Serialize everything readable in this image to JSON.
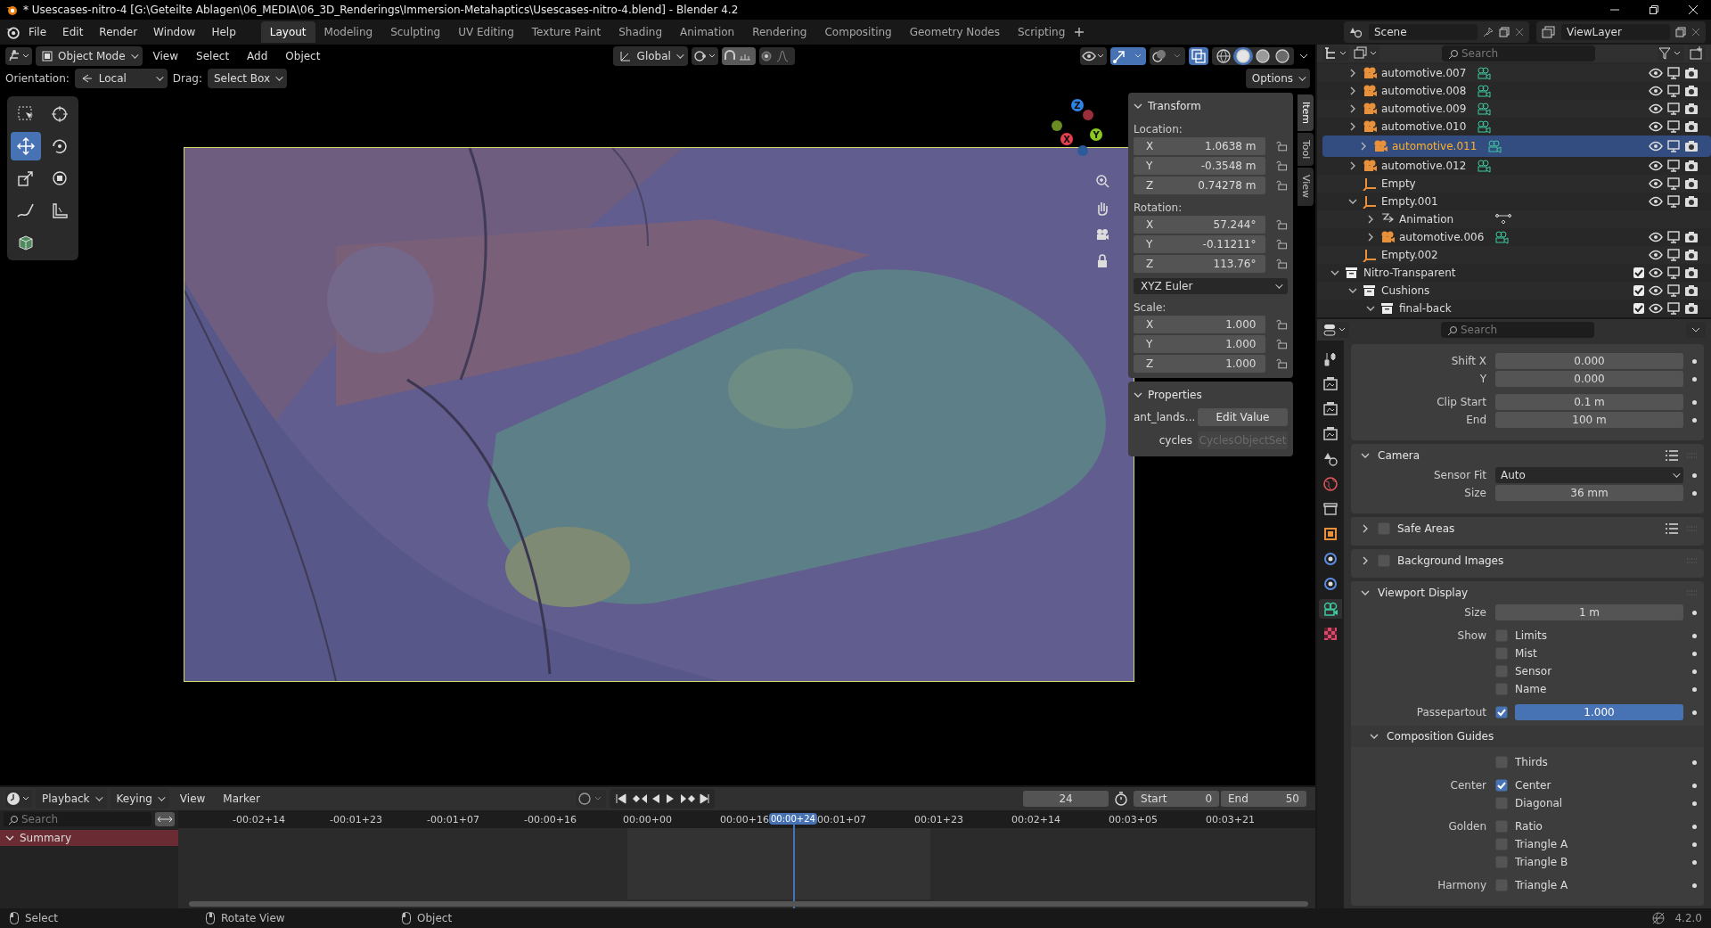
{
  "window": {
    "title": "* Usescases-nitro-4 [G:\\Geteilte Ablagen\\06_MEDIA\\06_3D_Renderings\\Immersion-Metahaptics\\Usescases-nitro-4.blend] - Blender 4.2"
  },
  "menu": [
    "File",
    "Edit",
    "Render",
    "Window",
    "Help"
  ],
  "workspaces": [
    {
      "label": "Layout",
      "selected": true
    },
    {
      "label": "Modeling",
      "selected": false
    },
    {
      "label": "Sculpting",
      "selected": false
    },
    {
      "label": "UV Editing",
      "selected": false
    },
    {
      "label": "Texture Paint",
      "selected": false
    },
    {
      "label": "Shading",
      "selected": false
    },
    {
      "label": "Animation",
      "selected": false
    },
    {
      "label": "Rendering",
      "selected": false
    },
    {
      "label": "Compositing",
      "selected": false
    },
    {
      "label": "Geometry Nodes",
      "selected": false
    },
    {
      "label": "Scripting",
      "selected": false
    }
  ],
  "scene": "Scene",
  "view_layer": "ViewLayer",
  "viewport_header": {
    "mode": "Object Mode",
    "menus": [
      "View",
      "Select",
      "Add",
      "Object"
    ],
    "orientation": "Global"
  },
  "shading_modes": [
    {
      "kind": "wireframe",
      "selected": false
    },
    {
      "kind": "solid",
      "selected": true
    },
    {
      "kind": "material",
      "selected": false
    },
    {
      "kind": "rendered",
      "selected": false
    }
  ],
  "tool_settings": {
    "orientation_label": "Orientation:",
    "orientation": "Local",
    "drag_label": "Drag:",
    "drag": "Select Box",
    "options": "Options"
  },
  "tools": [
    {
      "kind": "select_box",
      "selected": false
    },
    {
      "kind": "cursor",
      "selected": false
    },
    {
      "kind": "move",
      "selected": true
    },
    {
      "kind": "rotate",
      "selected": false
    },
    {
      "kind": "scale",
      "selected": false
    },
    {
      "kind": "transform",
      "selected": false
    },
    {
      "kind": "annotate",
      "selected": false
    },
    {
      "kind": "measure",
      "selected": false
    },
    {
      "kind": "add_cube",
      "selected": false
    }
  ],
  "gizmo": [
    {
      "label": "Z",
      "color": "#2f83e3"
    },
    {
      "label": "Y",
      "color": "#8bc91e"
    },
    {
      "label": "X",
      "color": "#e8404f"
    }
  ],
  "sidebar_tabs": [
    {
      "label": "Item",
      "selected": true
    },
    {
      "label": "Tool",
      "selected": false
    },
    {
      "label": "View",
      "selected": false
    }
  ],
  "transform": {
    "title": "Transform",
    "expanded": true,
    "location_label": "Location:",
    "location": [
      {
        "axis": "X",
        "value": "1.0638 m"
      },
      {
        "axis": "Y",
        "value": "-0.3548 m"
      },
      {
        "axis": "Z",
        "value": "0.74278 m"
      }
    ],
    "rotation_label": "Rotation:",
    "rotation": [
      {
        "axis": "X",
        "value": "57.244°"
      },
      {
        "axis": "Y",
        "value": "-0.11211°"
      },
      {
        "axis": "Z",
        "value": "113.76°"
      }
    ],
    "rotation_mode": "XYZ Euler",
    "scale_label": "Scale:",
    "scale": [
      {
        "axis": "X",
        "value": "1.000"
      },
      {
        "axis": "Y",
        "value": "1.000"
      },
      {
        "axis": "Z",
        "value": "1.000"
      }
    ]
  },
  "custom_properties": {
    "title": "Properties",
    "expanded": true,
    "rows": [
      {
        "label": "ant_lands...",
        "button": "Edit Value",
        "disabled": false
      },
      {
        "label": "cycles",
        "button": "CyclesObjectSet",
        "disabled": true
      }
    ]
  },
  "outliner": {
    "search_placeholder": "Search",
    "tree": [
      {
        "children": [
          {
            "label": "automotive.007",
            "kind": "object",
            "expanded": false,
            "selected": false
          },
          {
            "label": "automotive.008",
            "kind": "object",
            "expanded": false,
            "selected": false
          },
          {
            "label": "automotive.009",
            "kind": "object",
            "expanded": false,
            "selected": false
          },
          {
            "label": "automotive.010",
            "kind": "object",
            "expanded": false,
            "selected": false
          },
          {
            "label": "automotive.011",
            "kind": "object",
            "expanded": false,
            "selected": true
          },
          {
            "label": "automotive.012",
            "kind": "object",
            "expanded": false,
            "selected": false
          },
          {
            "label": "Empty",
            "kind": "empty",
            "selected": false
          },
          {
            "label": "Empty.001",
            "kind": "empty",
            "expanded": true,
            "selected": false,
            "children": [
              {
                "label": "Animation",
                "kind": "animation",
                "expanded": false,
                "selected": false
              },
              {
                "label": "automotive.006",
                "kind": "object",
                "expanded": false,
                "selected": false
              }
            ]
          },
          {
            "label": "Empty.002",
            "kind": "empty",
            "selected": false
          }
        ]
      },
      {
        "label": "Nitro-Transparent",
        "kind": "collection",
        "expanded": true,
        "selected": false,
        "checked": true,
        "children": [
          {
            "label": "Cushions",
            "kind": "collection",
            "expanded": true,
            "selected": false,
            "checked": true,
            "children": [
              {
                "label": "final-back",
                "kind": "collection",
                "expanded": true,
                "selected": false,
                "checked": true
              }
            ]
          }
        ]
      }
    ]
  },
  "property_tabs": [
    {
      "kind": "tool",
      "selected": false
    },
    {
      "kind": "render",
      "selected": false
    },
    {
      "kind": "output",
      "selected": false
    },
    {
      "kind": "view_layer",
      "selected": false
    },
    {
      "kind": "scene",
      "selected": false
    },
    {
      "kind": "world",
      "selected": false
    },
    {
      "kind": "collection",
      "selected": false
    },
    {
      "kind": "object",
      "selected": false
    },
    {
      "kind": "physics",
      "selected": false
    },
    {
      "kind": "constraints",
      "selected": false
    },
    {
      "kind": "camera_data",
      "selected": true
    },
    {
      "kind": "texture",
      "selected": false
    }
  ],
  "properties": {
    "search_placeholder": "Search",
    "top_groups": [
      [
        {
          "kind": "field",
          "label": "Shift X",
          "value": "0.000"
        },
        {
          "kind": "field",
          "label": "Y",
          "value": "0.000"
        }
      ],
      [
        {
          "kind": "field",
          "label": "Clip Start",
          "value": "0.1 m"
        },
        {
          "kind": "field",
          "label": "End",
          "value": "100 m"
        }
      ]
    ],
    "panels": [
      {
        "title": "Camera",
        "kind": "plain",
        "expanded": true,
        "presets": true,
        "groups": [
          [
            {
              "kind": "dropdown",
              "label": "Sensor Fit",
              "value": "Auto"
            },
            {
              "kind": "field",
              "label": "Size",
              "value": "36 mm"
            }
          ]
        ]
      },
      {
        "title": "Safe Areas",
        "kind": "toggle",
        "checked": false,
        "expanded": false,
        "presets": true
      },
      {
        "title": "Background Images",
        "kind": "toggle",
        "checked": false,
        "expanded": false,
        "presets": false
      },
      {
        "title": "Viewport Display",
        "kind": "plain",
        "expanded": true,
        "presets": false,
        "groups": [
          [
            {
              "kind": "field",
              "label": "Size",
              "value": "1 m"
            }
          ],
          [
            {
              "kind": "checkbox",
              "label": "Show",
              "text": "Limits",
              "checked": false
            },
            {
              "kind": "checkbox",
              "text": "Mist",
              "checked": false
            },
            {
              "kind": "checkbox",
              "text": "Sensor",
              "checked": false
            },
            {
              "kind": "checkbox",
              "text": "Name",
              "checked": false
            }
          ],
          [
            {
              "kind": "slider",
              "label": "Passepartout",
              "checked": true,
              "value": "1.000",
              "level": 1.0
            }
          ]
        ],
        "subpanel": {
          "title": "Composition Guides",
          "expanded": true,
          "groups": [
            [
              {
                "kind": "checkbox",
                "text": "Thirds",
                "checked": false
              }
            ],
            [
              {
                "kind": "checkbox",
                "label": "Center",
                "text": "Center",
                "checked": true
              },
              {
                "kind": "checkbox",
                "text": "Diagonal",
                "checked": false
              }
            ],
            [
              {
                "kind": "checkbox",
                "label": "Golden",
                "text": "Ratio",
                "checked": false
              },
              {
                "kind": "checkbox",
                "text": "Triangle A",
                "checked": false
              },
              {
                "kind": "checkbox",
                "text": "Triangle B",
                "checked": false
              }
            ],
            [
              {
                "kind": "checkbox",
                "label": "Harmony",
                "text": "Triangle A",
                "checked": false
              }
            ]
          ]
        }
      }
    ]
  },
  "timeline": {
    "menus": [
      "Playback",
      "Keying",
      "View",
      "Marker"
    ],
    "frame": "24",
    "start_label": "Start",
    "start": "0",
    "end_label": "End",
    "end": "50",
    "search_placeholder": "Search",
    "channel": "Summary",
    "ticks": [
      "-00:02+14",
      "-00:01+23",
      "-00:01+07",
      "-00:00+16",
      "00:00+00",
      "00:00+16",
      "00:01+07",
      "00:01+23",
      "00:02+14",
      "00:03+05",
      "00:03+21"
    ],
    "current": "00:00+24"
  },
  "status_bar": {
    "items": [
      "Select",
      "Rotate View",
      "Object"
    ],
    "version": "4.2.0"
  }
}
